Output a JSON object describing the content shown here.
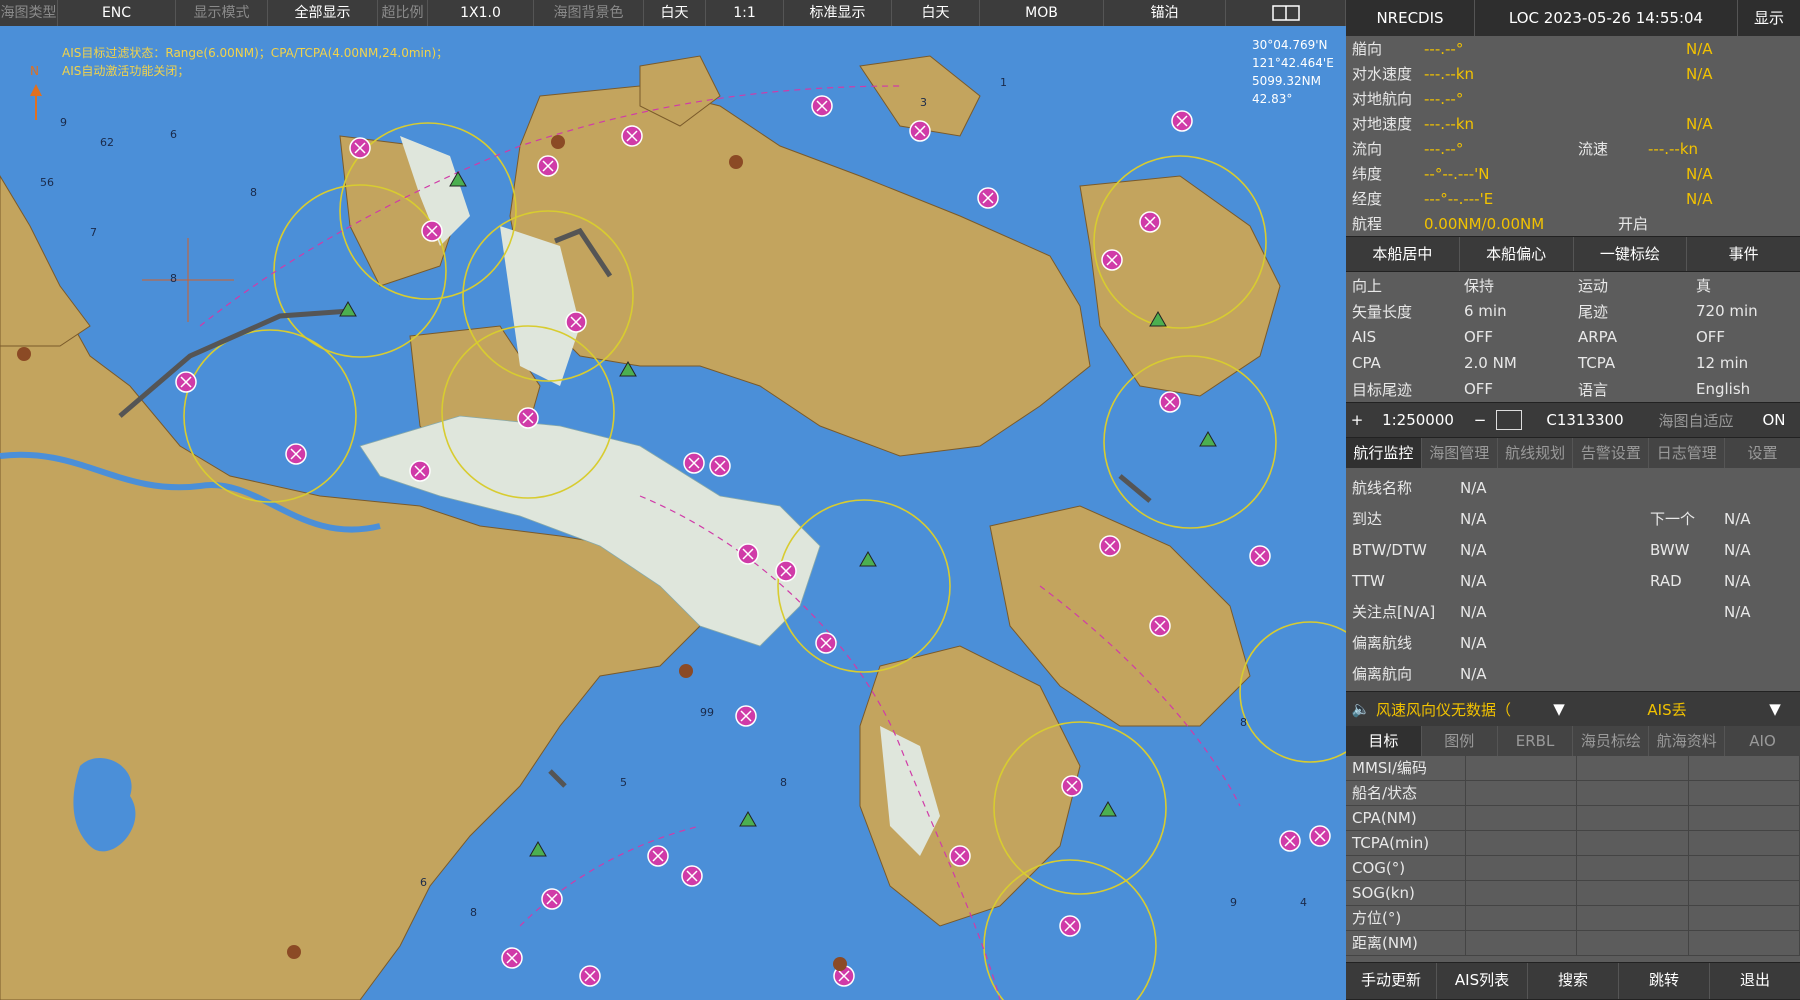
{
  "toolbar": {
    "chart_type_label": "海图类型",
    "chart_type_value": "ENC",
    "display_mode_label": "显示模式",
    "display_mode_value": "全部显示",
    "scale_ratio_label": "超比例",
    "scale_ratio_value": "1X1.0",
    "background_label": "海图背景色",
    "background_value": "白天",
    "ratio_value": "1:1",
    "standard_display": "标准显示",
    "daytime": "白天",
    "mob": "MOB",
    "anchor_watch": "锚泊"
  },
  "chart": {
    "ais_status_line1": "AIS目标过滤状态：Range(6.00NM)；CPA/TCPA(4.00NM,24.0min)；",
    "ais_status_line2": "AIS自动激活功能关闭；",
    "north_label": "N",
    "cursor_lat": "30°04.769'N",
    "cursor_lon": "121°42.464'E",
    "cursor_range": "5099.32NM",
    "cursor_bearing": "42.83°",
    "colors": {
      "water": "#4b8fd8",
      "land": "#c3a45e",
      "shallow": "#dfe6dc",
      "ais": "#d03ba8",
      "circle": "#d8cc30"
    }
  },
  "panel": {
    "header": {
      "system": "NRECDIS",
      "loc": "LOC 2023-05-26 14:55:04",
      "display": "显示"
    },
    "nav": [
      {
        "label": "艏向",
        "value": "---.--°",
        "extra": "N/A"
      },
      {
        "label": "对水速度",
        "value": "---.--kn",
        "extra": "N/A"
      },
      {
        "label": "对地航向",
        "value": "---.--°",
        "extra": ""
      },
      {
        "label": "对地速度",
        "value": "---.--kn",
        "extra": "N/A"
      }
    ],
    "current": {
      "label": "流向",
      "value": "---.--°",
      "label2": "流速",
      "value2": "---.--kn"
    },
    "position": [
      {
        "label": "纬度",
        "value": "--°--.---'N",
        "extra": "N/A"
      },
      {
        "label": "经度",
        "value": "---°--.---'E",
        "extra": "N/A"
      }
    ],
    "voyage": {
      "label": "航程",
      "value": "0.00NM/0.00NM",
      "state": "开启"
    },
    "action_buttons": [
      "本船居中",
      "本船偏心",
      "一键标绘",
      "事件"
    ],
    "settings": [
      {
        "k1": "向上",
        "v1": "保持",
        "k2": "运动",
        "v2": "真"
      },
      {
        "k1": "矢量长度",
        "v1": "6 min",
        "k2": "尾迹",
        "v2": "720 min"
      },
      {
        "k1": "AIS",
        "v1": "OFF",
        "k2": "ARPA",
        "v2": "OFF"
      },
      {
        "k1": "CPA",
        "v1": "2.0 NM",
        "k2": "TCPA",
        "v2": "12 min"
      },
      {
        "k1": "目标尾迹",
        "v1": "OFF",
        "k2": "语言",
        "v2": "English"
      }
    ],
    "scale_bar": {
      "plus": "+",
      "scale": "1:250000",
      "minus": "−",
      "cell": "C1313300",
      "auto_label": "海图自适应",
      "auto_value": "ON"
    },
    "tabs1": [
      "航行监控",
      "海图管理",
      "航线规划",
      "告警设置",
      "日志管理",
      "设置"
    ],
    "route": [
      {
        "k1": "航线名称",
        "v1": "N/A",
        "k2": "",
        "v2": ""
      },
      {
        "k1": "到达",
        "v1": "N/A",
        "k2": "下一个",
        "v2": "N/A"
      },
      {
        "k1": "BTW/DTW",
        "v1": "N/A",
        "k2": "BWW",
        "v2": "N/A"
      },
      {
        "k1": "TTW",
        "v1": "N/A",
        "k2": "RAD",
        "v2": "N/A"
      },
      {
        "k1": "关注点[N/A]",
        "v1": "N/A",
        "k2": "",
        "v2": "N/A"
      },
      {
        "k1": "偏离航线",
        "v1": "N/A",
        "k2": "",
        "v2": ""
      },
      {
        "k1": "偏离航向",
        "v1": "N/A",
        "k2": "",
        "v2": ""
      }
    ],
    "alerts": {
      "wind": "风速风向仪无数据（",
      "ais": "AIS丢"
    },
    "tabs2": [
      "目标",
      "图例",
      "ERBL",
      "海员标绘",
      "航海资料",
      "AIO"
    ],
    "target_fields": [
      "MMSI/编码",
      "船名/状态",
      "CPA(NM)",
      "TCPA(min)",
      "COG(°)",
      "SOG(kn)",
      "方位(°)",
      "距离(NM)"
    ],
    "bottom_buttons": [
      "手动更新",
      "AIS列表",
      "搜索",
      "跳转",
      "退出"
    ]
  }
}
